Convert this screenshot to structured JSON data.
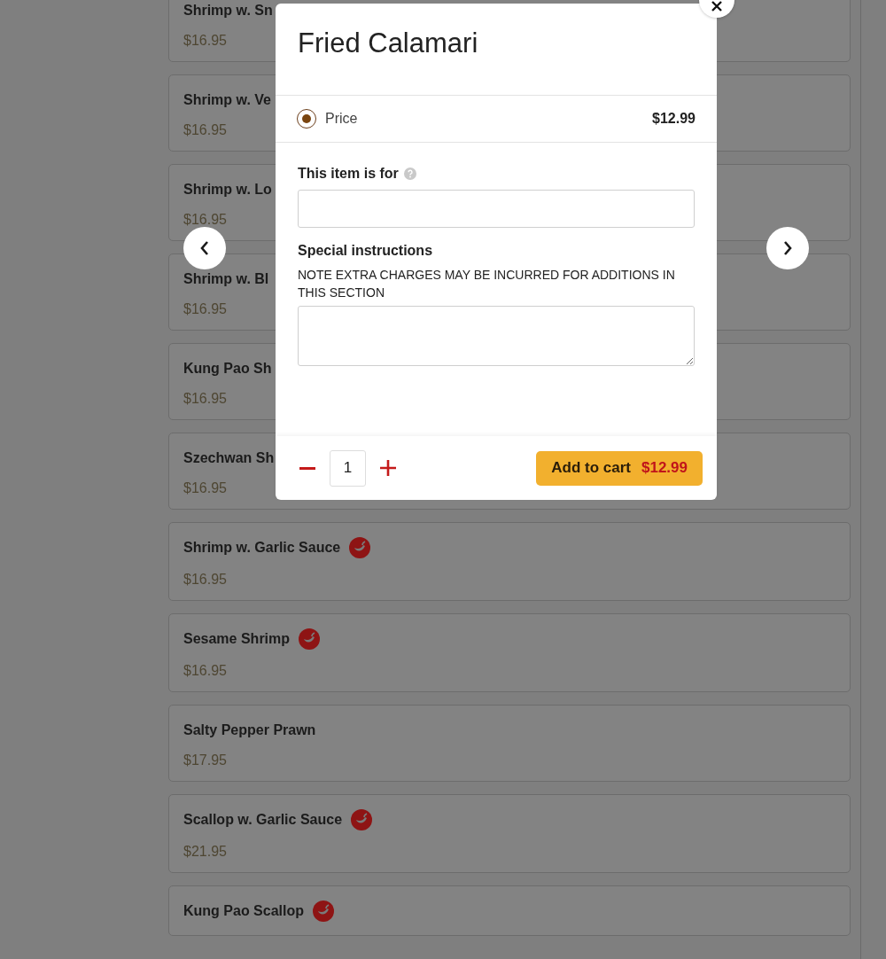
{
  "menu_items": [
    {
      "name": "Shrimp w. Sn",
      "price": "$16.95",
      "spicy": false
    },
    {
      "name": "Shrimp w. Ve",
      "price": "$16.95",
      "spicy": false
    },
    {
      "name": "Shrimp w. Lo",
      "price": "$16.95",
      "spicy": false
    },
    {
      "name": "Shrimp w. Bl",
      "price": "$16.95",
      "spicy": false
    },
    {
      "name": "Kung Pao Sh",
      "price": "$16.95",
      "spicy": false
    },
    {
      "name": "Szechwan Sh",
      "price": "$16.95",
      "spicy": false
    },
    {
      "name": "Shrimp w. Garlic Sauce",
      "price": "$16.95",
      "spicy": true
    },
    {
      "name": "Sesame Shrimp",
      "price": "$16.95",
      "spicy": true
    },
    {
      "name": "Salty Pepper Prawn",
      "price": "$17.95",
      "spicy": false
    },
    {
      "name": "Scallop w. Garlic Sauce",
      "price": "$21.95",
      "spicy": true
    },
    {
      "name": "Kung Pao Scallop",
      "spicy": true
    }
  ],
  "modal": {
    "title": "Fried Calamari",
    "options": [
      {
        "label": "Price",
        "price": "$12.99",
        "selected": true
      }
    ],
    "fields": [
      {
        "kind": "input",
        "label": "This item is for",
        "help": true
      },
      {
        "kind": "textarea",
        "label": "Special instructions",
        "note": "NOTE EXTRA CHARGES MAY BE INCURRED FOR ADDITIONS IN THIS SECTION",
        "help": false
      }
    ],
    "quantity": "1",
    "add_button": {
      "label": "Add to cart",
      "price": "$12.99"
    }
  }
}
